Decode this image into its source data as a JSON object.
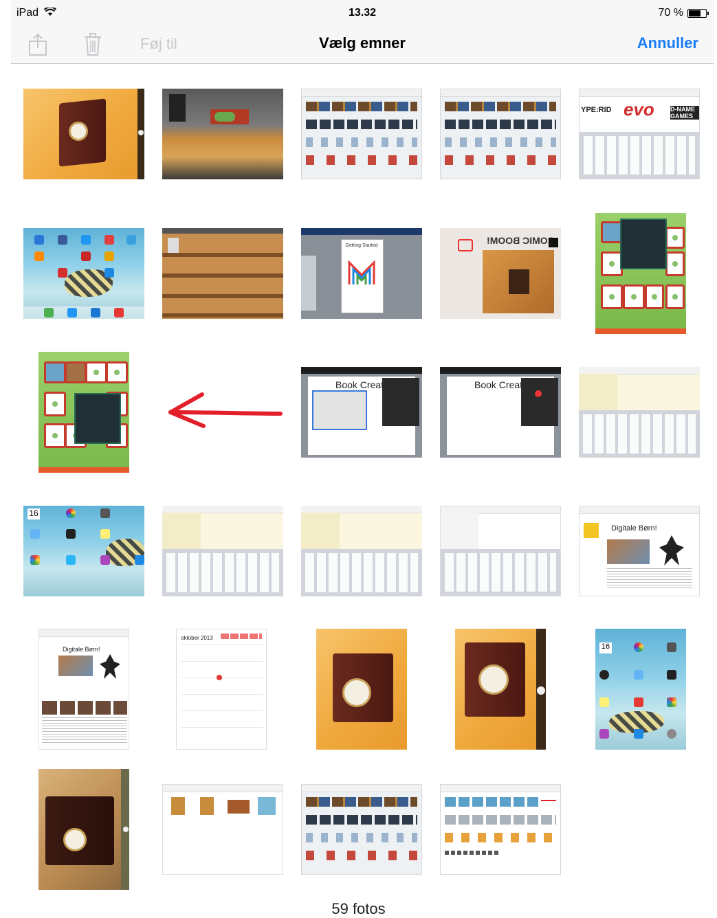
{
  "status_bar": {
    "device": "iPad",
    "time": "13.32",
    "battery_text": "70 %",
    "battery_level_percent": 70
  },
  "nav_bar": {
    "title": "Vælg emner",
    "add_label": "Føj til",
    "cancel_label": "Annuller",
    "share_icon": "share-icon",
    "trash_icon": "trash-icon"
  },
  "thumb_text": {
    "evo": "evo",
    "dname": "D-NAME GAMES",
    "type_rid": "YPE:RID",
    "getting_started": "Getting Started",
    "book_creator_1": "Book Creat",
    "book_creator_2": "Book Creat",
    "comic": "COMIC BOOM!",
    "digitale_born_1": "Digitale Børn!",
    "digitale_born_2": "Digitale Børn!",
    "oktober": "oktober 2013",
    "date_16": "16",
    "date_16b": "16"
  },
  "footer": {
    "count_label": "59 fotos"
  },
  "colors": {
    "accent": "#1a7cf5",
    "disabled": "#c7c7cc",
    "arrow": "#e3202a"
  }
}
